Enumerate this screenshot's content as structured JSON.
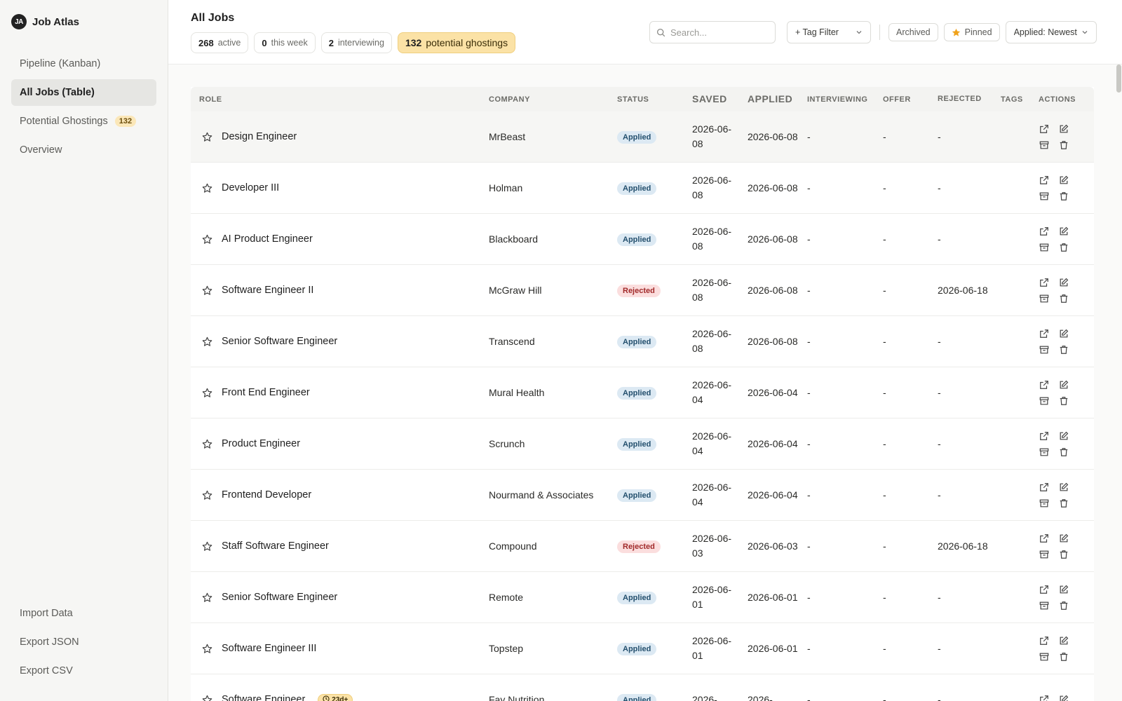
{
  "brand": {
    "logo": "JA",
    "name": "Job Atlas"
  },
  "nav": [
    {
      "label": "Pipeline (Kanban)",
      "active": false,
      "badge": ""
    },
    {
      "label": "All Jobs (Table)",
      "active": true,
      "badge": ""
    },
    {
      "label": "Potential Ghostings",
      "active": false,
      "badge": "132"
    },
    {
      "label": "Overview",
      "active": false,
      "badge": ""
    }
  ],
  "nav_bottom": [
    {
      "label": "Import Data"
    },
    {
      "label": "Export JSON"
    },
    {
      "label": "Export CSV"
    }
  ],
  "header": {
    "title": "All Jobs",
    "stats": [
      {
        "value": "268",
        "label": "active"
      },
      {
        "value": "0",
        "label": "this week"
      },
      {
        "value": "2",
        "label": "interviewing"
      },
      {
        "value": "132",
        "label": "potential ghostings"
      }
    ],
    "search_placeholder": "Search...",
    "tag_filter_label": "+ Tag Filter",
    "archived_label": "Archived",
    "pinned_label": "Pinned",
    "sort_label": "Applied: Newest"
  },
  "table": {
    "columns": [
      "Role",
      "Company",
      "Status",
      "Saved",
      "Applied",
      "Interviewing",
      "Offer",
      "Rejected",
      "Tags",
      "Actions"
    ],
    "rows": [
      {
        "role": "Design Engineer",
        "company": "MrBeast",
        "status": "Applied",
        "saved": "2026-06-08",
        "applied": "2026-06-08",
        "interviewing": "-",
        "offer": "-",
        "rejected": "-",
        "tags": "",
        "age": ""
      },
      {
        "role": "Developer III",
        "company": "Holman",
        "status": "Applied",
        "saved": "2026-06-08",
        "applied": "2026-06-08",
        "interviewing": "-",
        "offer": "-",
        "rejected": "-",
        "tags": "",
        "age": ""
      },
      {
        "role": "AI Product Engineer",
        "company": "Blackboard",
        "status": "Applied",
        "saved": "2026-06-08",
        "applied": "2026-06-08",
        "interviewing": "-",
        "offer": "-",
        "rejected": "-",
        "tags": "",
        "age": ""
      },
      {
        "role": "Software Engineer II",
        "company": "McGraw Hill",
        "status": "Rejected",
        "saved": "2026-06-08",
        "applied": "2026-06-08",
        "interviewing": "-",
        "offer": "-",
        "rejected": "2026-06-18",
        "tags": "",
        "age": ""
      },
      {
        "role": "Senior Software Engineer",
        "company": "Transcend",
        "status": "Applied",
        "saved": "2026-06-08",
        "applied": "2026-06-08",
        "interviewing": "-",
        "offer": "-",
        "rejected": "-",
        "tags": "",
        "age": ""
      },
      {
        "role": "Front End Engineer",
        "company": "Mural Health",
        "status": "Applied",
        "saved": "2026-06-04",
        "applied": "2026-06-04",
        "interviewing": "-",
        "offer": "-",
        "rejected": "-",
        "tags": "",
        "age": ""
      },
      {
        "role": "Product Engineer",
        "company": "Scrunch",
        "status": "Applied",
        "saved": "2026-06-04",
        "applied": "2026-06-04",
        "interviewing": "-",
        "offer": "-",
        "rejected": "-",
        "tags": "",
        "age": ""
      },
      {
        "role": "Frontend Developer",
        "company": "Nourmand & Associates",
        "status": "Applied",
        "saved": "2026-06-04",
        "applied": "2026-06-04",
        "interviewing": "-",
        "offer": "-",
        "rejected": "-",
        "tags": "",
        "age": ""
      },
      {
        "role": "Staff Software Engineer",
        "company": "Compound",
        "status": "Rejected",
        "saved": "2026-06-03",
        "applied": "2026-06-03",
        "interviewing": "-",
        "offer": "-",
        "rejected": "2026-06-18",
        "tags": "",
        "age": ""
      },
      {
        "role": "Senior Software Engineer",
        "company": "Remote",
        "status": "Applied",
        "saved": "2026-06-01",
        "applied": "2026-06-01",
        "interviewing": "-",
        "offer": "-",
        "rejected": "-",
        "tags": "",
        "age": ""
      },
      {
        "role": "Software Engineer III",
        "company": "Topstep",
        "status": "Applied",
        "saved": "2026-06-01",
        "applied": "2026-06-01",
        "interviewing": "-",
        "offer": "-",
        "rejected": "-",
        "tags": "",
        "age": ""
      },
      {
        "role": "Software Engineer",
        "company": "Fay Nutrition",
        "status": "Applied",
        "saved": "2026-",
        "applied": "2026-",
        "interviewing": "-",
        "offer": "-",
        "rejected": "-",
        "tags": "",
        "age": "23d+"
      }
    ]
  },
  "icons": {
    "star": "star-icon",
    "open": "external-link-icon",
    "edit": "edit-icon",
    "archive": "archive-icon",
    "delete": "trash-icon",
    "search": "search-icon",
    "pinned": "star-filled-icon",
    "chevron": "chevron-down-icon",
    "clock": "clock-icon"
  },
  "colors": {
    "accent_pinned": "#f0a21b",
    "ghosting_bg": "#fbe2a6",
    "applied_bg": "#dce9f3",
    "rejected_bg": "#fbdede"
  }
}
